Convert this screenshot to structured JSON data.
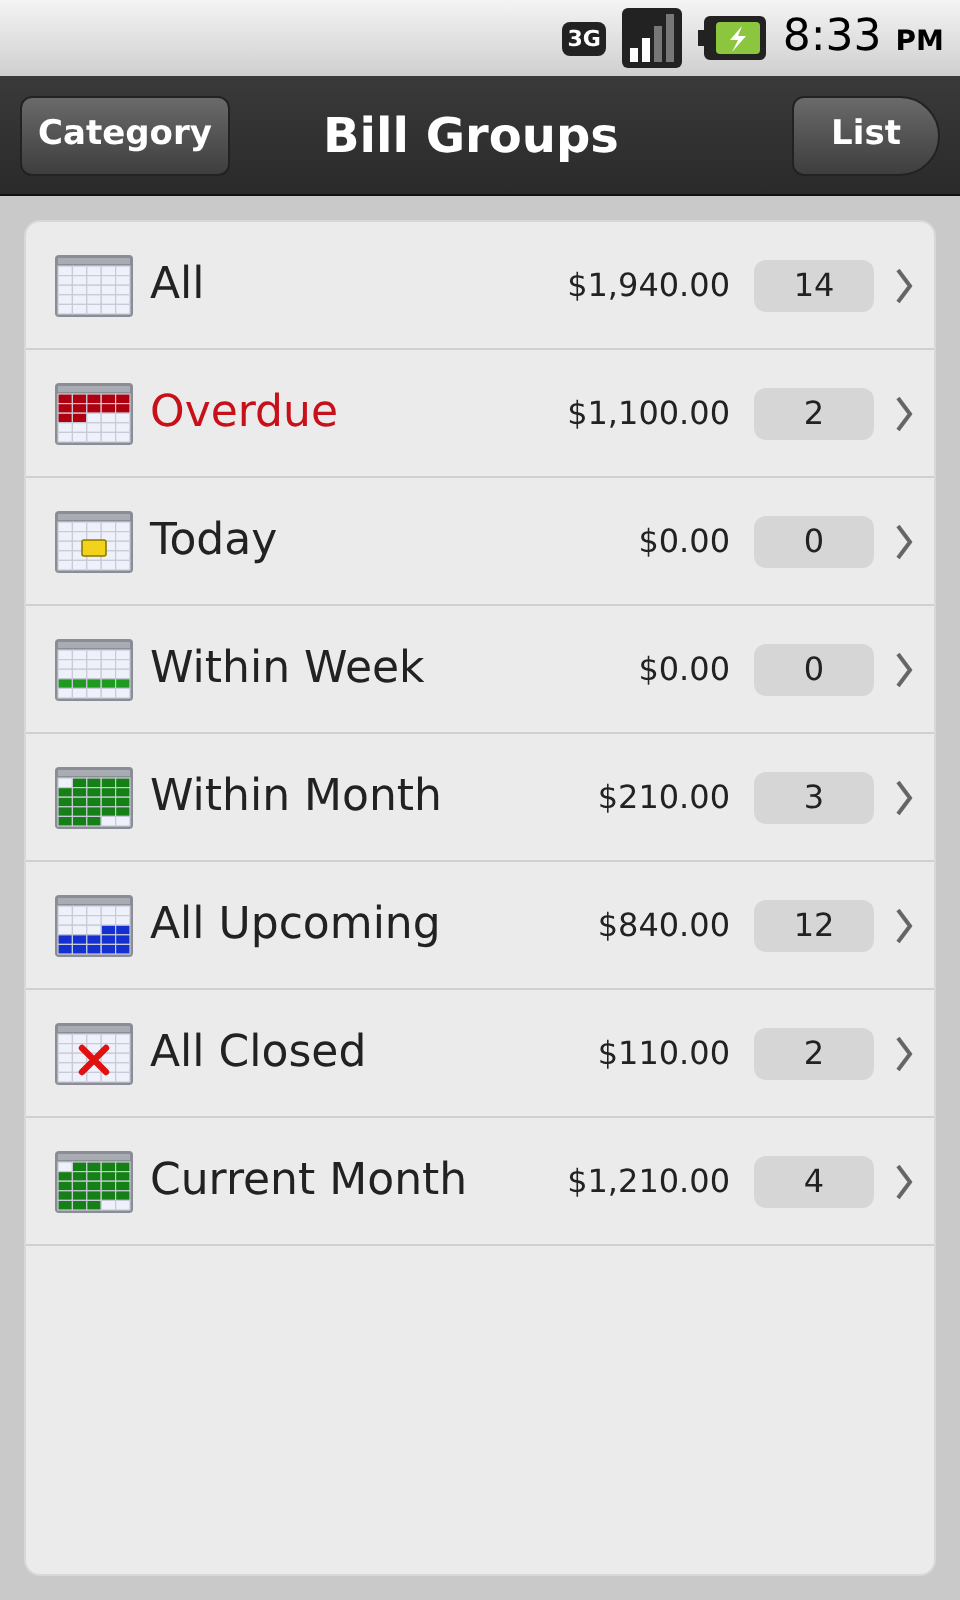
{
  "status_bar": {
    "network": "3G",
    "time": "8:33",
    "ampm": "PM"
  },
  "header": {
    "left_button": "Category",
    "title": "Bill Groups",
    "right_button": "List"
  },
  "groups": [
    {
      "kind": "all",
      "name": "All",
      "overdue": false,
      "amount": "$1,940.00",
      "count": "14"
    },
    {
      "kind": "overdue",
      "name": "Overdue",
      "overdue": true,
      "amount": "$1,100.00",
      "count": "2"
    },
    {
      "kind": "today",
      "name": "Today",
      "overdue": false,
      "amount": "$0.00",
      "count": "0"
    },
    {
      "kind": "week",
      "name": "Within Week",
      "overdue": false,
      "amount": "$0.00",
      "count": "0"
    },
    {
      "kind": "month",
      "name": "Within Month",
      "overdue": false,
      "amount": "$210.00",
      "count": "3"
    },
    {
      "kind": "upcoming",
      "name": "All Upcoming",
      "overdue": false,
      "amount": "$840.00",
      "count": "12"
    },
    {
      "kind": "closed",
      "name": "All Closed",
      "overdue": false,
      "amount": "$110.00",
      "count": "2"
    },
    {
      "kind": "month",
      "name": "Current Month",
      "overdue": false,
      "amount": "$1,210.00",
      "count": "4"
    }
  ]
}
